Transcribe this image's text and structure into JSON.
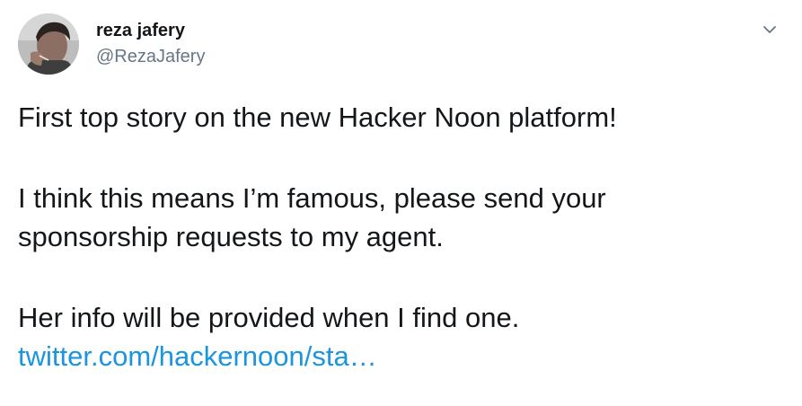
{
  "user": {
    "name": "reza jafery",
    "handle": "@RezaJafery"
  },
  "tweet": {
    "lines": [
      "First top story on the new Hacker Noon platform!",
      "I think this means I’m famous, please send your",
      "sponsorship requests to my agent.",
      "Her info will be provided when I find one."
    ],
    "link_text": "twitter.com/hackernoon/sta…"
  },
  "icons": {
    "menu": "chevron-down-icon"
  },
  "colors": {
    "text": "#14171a",
    "secondary_text": "#657786",
    "link": "#1b95e0",
    "icon": "#657786"
  }
}
